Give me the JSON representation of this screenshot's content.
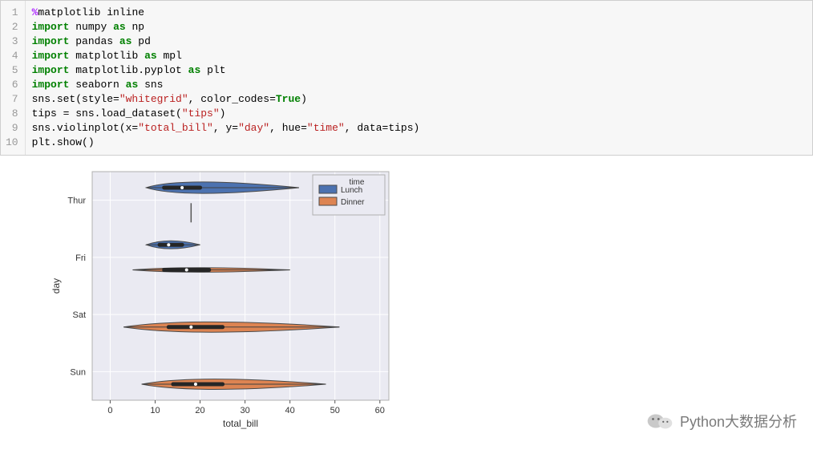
{
  "code": {
    "line1_magic": "%",
    "line1_rest": "matplotlib inline",
    "import_kw": "import",
    "as_kw": "as",
    "line2_mod": "numpy",
    "line2_as": "np",
    "line3_mod": "pandas",
    "line3_as": "pd",
    "line4_mod": "matplotlib",
    "line4_as": "mpl",
    "line5_mod": "matplotlib.pyplot",
    "line5_as": "plt",
    "line6_mod": "seaborn",
    "line6_as": "sns",
    "line7_a": "sns.set(style=",
    "line7_s1": "\"whitegrid\"",
    "line7_b": ", color_codes=",
    "line7_true": "True",
    "line7_c": ")",
    "line8_a": "tips = sns.load_dataset(",
    "line8_s1": "\"tips\"",
    "line8_b": ")",
    "line9_a": "sns.violinplot(x=",
    "line9_s1": "\"total_bill\"",
    "line9_b": ", y=",
    "line9_s2": "\"day\"",
    "line9_c": ", hue=",
    "line9_s3": "\"time\"",
    "line9_d": ", data=tips)",
    "line10": "plt.show()",
    "line_numbers": [
      "1",
      "2",
      "3",
      "4",
      "5",
      "6",
      "7",
      "8",
      "9",
      "10"
    ]
  },
  "chart_data": {
    "type": "violin",
    "xlabel": "total_bill",
    "ylabel": "day",
    "hue_label": "time",
    "xticks": [
      0,
      10,
      20,
      30,
      40,
      50,
      60
    ],
    "categories": [
      "Thur",
      "Fri",
      "Sat",
      "Sun"
    ],
    "legend_title": "time",
    "legend_items": [
      "Lunch",
      "Dinner"
    ],
    "colors": {
      "Lunch": "#4c72b0",
      "Dinner": "#dd8452"
    },
    "series": [
      {
        "day": "Thur",
        "time": "Lunch",
        "median": 16,
        "q1": 12,
        "q3": 20,
        "min": 8,
        "max": 42,
        "width": 10
      },
      {
        "day": "Thur",
        "time": "Dinner",
        "median": 18,
        "q1": 18,
        "q3": 18,
        "min": 18,
        "max": 18,
        "width": 1
      },
      {
        "day": "Fri",
        "time": "Lunch",
        "median": 13,
        "q1": 11,
        "q3": 16,
        "min": 8,
        "max": 20,
        "width": 7
      },
      {
        "day": "Fri",
        "time": "Dinner",
        "median": 17,
        "q1": 12,
        "q3": 22,
        "min": 5,
        "max": 40,
        "width": 4
      },
      {
        "day": "Sat",
        "time": "Dinner",
        "median": 18,
        "q1": 13,
        "q3": 25,
        "min": 3,
        "max": 51,
        "width": 9
      },
      {
        "day": "Sun",
        "time": "Dinner",
        "median": 19,
        "q1": 14,
        "q3": 25,
        "min": 7,
        "max": 48,
        "width": 9
      }
    ],
    "xlim": [
      -4,
      62
    ]
  },
  "watermark": "Python大数据分析"
}
